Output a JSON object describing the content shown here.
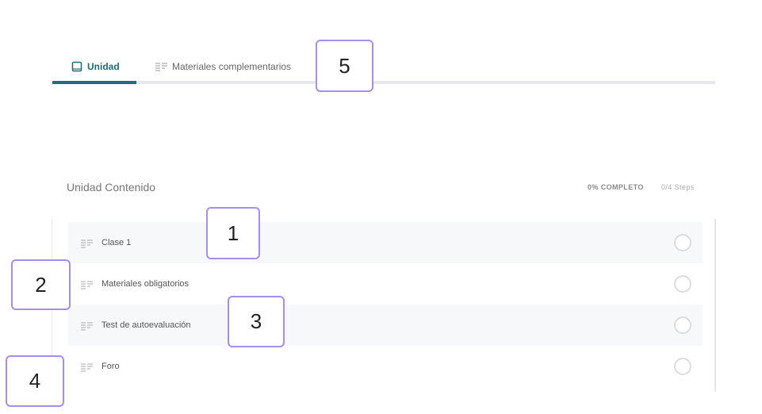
{
  "tabs": [
    {
      "label": "Unidad",
      "icon": "book-icon",
      "active": true
    },
    {
      "label": "Materiales complementarios",
      "icon": "lines-icon",
      "active": false
    }
  ],
  "section": {
    "title": "Unidad Contenido",
    "progress_percent": "0% COMPLETO",
    "progress_steps": "0/4 Steps"
  },
  "lessons": [
    {
      "label": "Clase 1",
      "icon": "lines-icon",
      "completed": false
    },
    {
      "label": "Materiales obligatorios",
      "icon": "lines-icon",
      "completed": false
    },
    {
      "label": "Test de autoevaluación",
      "icon": "lines-icon",
      "completed": false
    },
    {
      "label": "Foro",
      "icon": "lines-icon",
      "completed": false
    }
  ],
  "badges": [
    "1",
    "2",
    "3",
    "4",
    "5"
  ],
  "colors": {
    "accent": "#1f6f78",
    "badge_border": "#a98de8",
    "row_alt": "#f7f8fa"
  }
}
